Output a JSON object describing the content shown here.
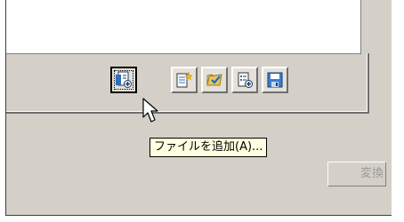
{
  "toolbar": {
    "buttons": [
      {
        "icon": "add-file-icon",
        "state": "focused"
      },
      {
        "icon": "new-sparkle-document-icon",
        "state": "normal"
      },
      {
        "icon": "folder-check-icon",
        "state": "normal"
      },
      {
        "icon": "document-add-icon",
        "state": "normal"
      },
      {
        "icon": "save-disk-icon",
        "state": "normal"
      }
    ]
  },
  "tooltip": {
    "text": "ファイルを追加(A)..."
  },
  "convert_button": {
    "label": "変換"
  },
  "colors": {
    "window_bg": "#d4d0c8",
    "tooltip_bg": "#ffffe1",
    "disabled_text": "#9a9a9a"
  }
}
